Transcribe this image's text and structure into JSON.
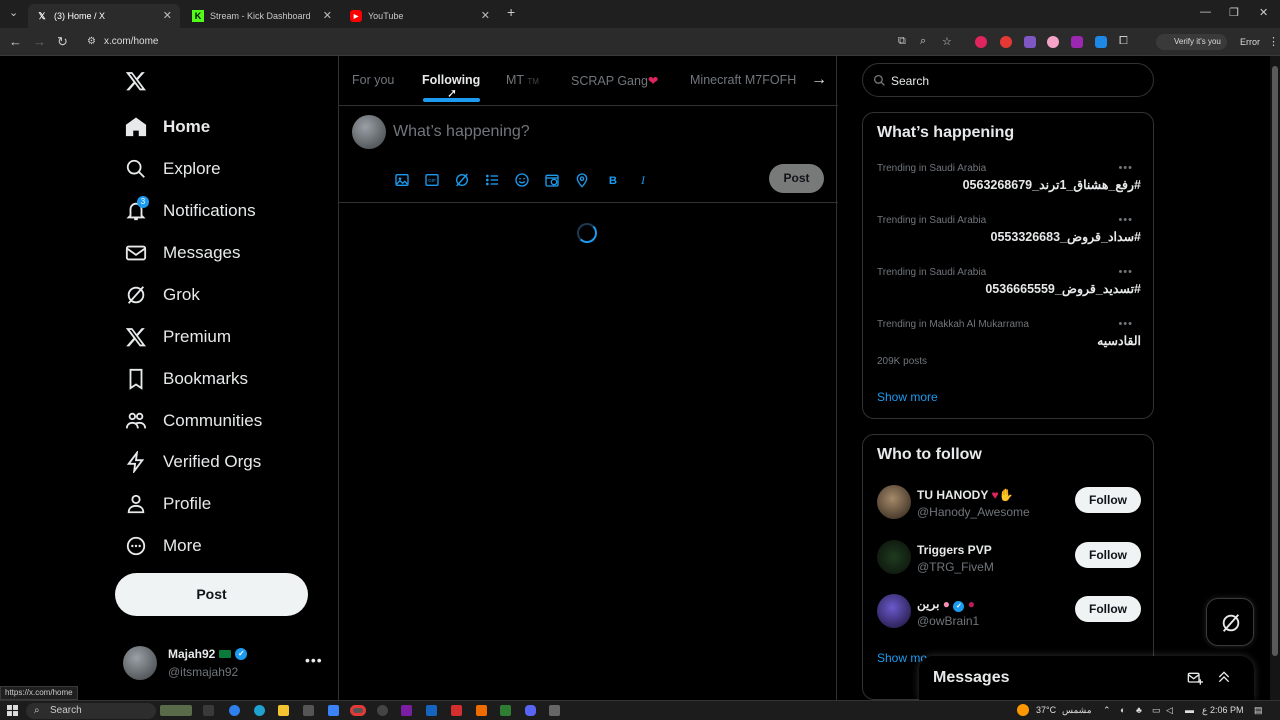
{
  "browser": {
    "tabs": [
      {
        "title": "(3) Home / X",
        "favicon": "x-logo-icon"
      },
      {
        "title": "Stream - Kick Dashboard",
        "favicon": "kick-icon"
      },
      {
        "title": "YouTube",
        "favicon": "youtube-icon"
      }
    ],
    "url": "x.com/home",
    "verify_label": "Verify it's you",
    "error_label": "Error",
    "status_url": "https://x.com/home"
  },
  "nav": {
    "items": [
      {
        "label": "Home",
        "icon": "home-icon"
      },
      {
        "label": "Explore",
        "icon": "search-icon"
      },
      {
        "label": "Notifications",
        "icon": "bell-icon",
        "badge": "3"
      },
      {
        "label": "Messages",
        "icon": "envelope-icon"
      },
      {
        "label": "Grok",
        "icon": "grok-icon"
      },
      {
        "label": "Premium",
        "icon": "x-logo-icon"
      },
      {
        "label": "Bookmarks",
        "icon": "bookmark-icon"
      },
      {
        "label": "Communities",
        "icon": "people-icon"
      },
      {
        "label": "Verified Orgs",
        "icon": "lightning-icon"
      },
      {
        "label": "Profile",
        "icon": "person-icon"
      },
      {
        "label": "More",
        "icon": "more-circle-icon"
      }
    ],
    "post_label": "Post",
    "account": {
      "name": "Majah92",
      "handle": "@itsmajah92"
    }
  },
  "feed": {
    "tabs": [
      "For you",
      "Following",
      "MT",
      "SCRAP Gang",
      "Minecraft M7FOFH"
    ],
    "tab_suffix_mt": "TM",
    "active_tab": "Following",
    "compose_placeholder": "What’s happening?",
    "compose_post": "Post"
  },
  "sidebar": {
    "search_placeholder": "Search",
    "whats_happening": {
      "title": "What’s happening",
      "trends": [
        {
          "context": "Trending in Saudi Arabia",
          "topic": "#رفع_هشناق_1ترند_0563268679",
          "posts": ""
        },
        {
          "context": "Trending in Saudi Arabia",
          "topic": "#سداد_قروض_0553326683",
          "posts": ""
        },
        {
          "context": "Trending in Saudi Arabia",
          "topic": "#تسديد_قروض_0536665559",
          "posts": ""
        },
        {
          "context": "Trending in Makkah Al Mukarrama",
          "topic": "القادسيه",
          "posts": "209K posts"
        }
      ],
      "show_more": "Show more"
    },
    "who_to_follow": {
      "title": "Who to follow",
      "accounts": [
        {
          "name": "TU HANODY",
          "handle": "@Hanody_Awesome",
          "follow": "Follow"
        },
        {
          "name": "Triggers PVP",
          "handle": "@TRG_FiveM",
          "follow": "Follow"
        },
        {
          "name": "برين",
          "handle": "@owBrain1",
          "follow": "Follow"
        }
      ],
      "show_more": "Show mo"
    },
    "messages_label": "Messages"
  },
  "taskbar": {
    "search_label": "Search",
    "weather": "37°C",
    "weather_text": "مشمس",
    "lang": "ع",
    "time": "2:06 PM"
  },
  "colors": {
    "accent": "#1d9bf0",
    "background": "#000000",
    "muted": "#71767b"
  }
}
